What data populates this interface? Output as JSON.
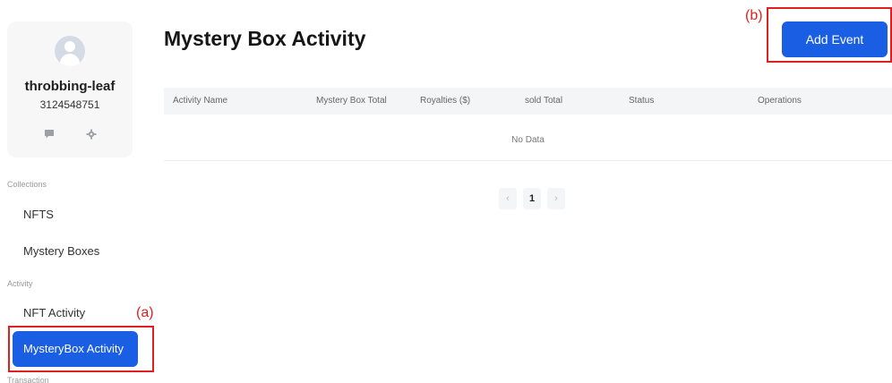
{
  "profile": {
    "username": "throbbing-leaf",
    "user_id": "3124548751",
    "avatar_icon": "user-avatar-icon",
    "actions": [
      "chat-icon",
      "gear-icon"
    ]
  },
  "sidebar": {
    "sections": [
      {
        "label": "Collections",
        "items": [
          {
            "label": "NFTS"
          },
          {
            "label": "Mystery Boxes"
          }
        ]
      },
      {
        "label": "Activity",
        "items": [
          {
            "label": "NFT Activity"
          },
          {
            "label": "MysteryBox Activity",
            "active": true
          }
        ]
      },
      {
        "label": "Transaction",
        "items": []
      }
    ]
  },
  "header": {
    "title": "Mystery Box Activity",
    "add_button_label": "Add Event"
  },
  "table": {
    "columns": [
      "Activity Name",
      "Mystery Box Total",
      "Royalties ($)",
      "sold Total",
      "Status",
      "Operations"
    ],
    "rows": [],
    "empty_text": "No Data"
  },
  "pagination": {
    "prev": "‹",
    "current_page": "1",
    "next": "›"
  },
  "annotations": {
    "a": "(a)",
    "b": "(b)"
  },
  "colors": {
    "accent": "#1a5fe3",
    "annotation": "#e02020"
  }
}
